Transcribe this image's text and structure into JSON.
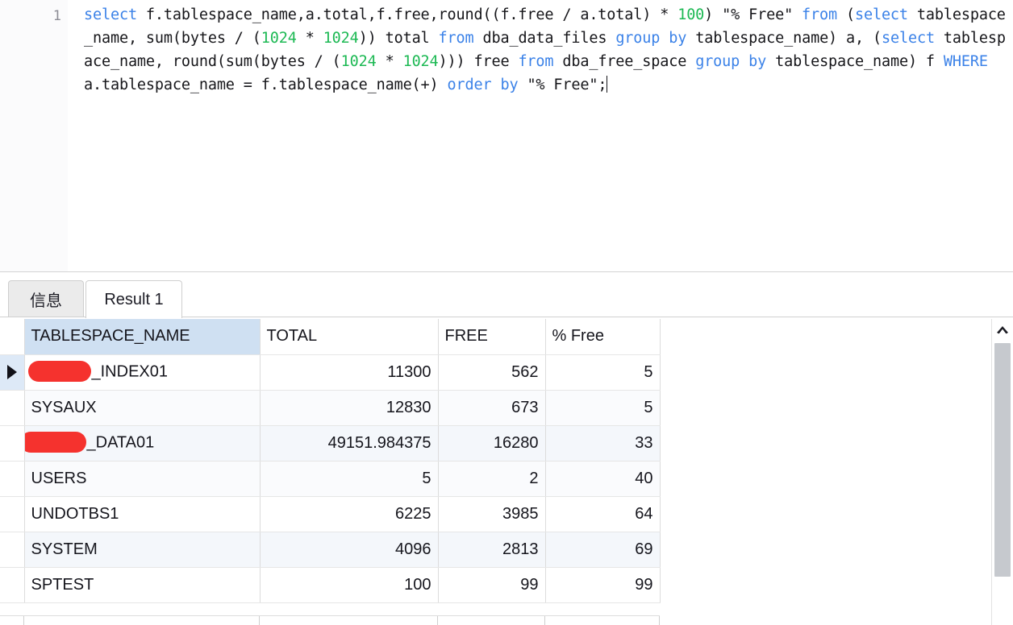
{
  "editor": {
    "line_number": "1",
    "sql_tokens": [
      {
        "t": "select",
        "c": "kw"
      },
      {
        "t": " f.tablespace_name,a.total,f.free,round((f.free / a.total) * ",
        "c": "plain"
      },
      {
        "t": "100",
        "c": "num"
      },
      {
        "t": ") \"% Free\" ",
        "c": "plain"
      },
      {
        "t": "from",
        "c": "kw"
      },
      {
        "t": " (",
        "c": "plain"
      },
      {
        "t": "select",
        "c": "kw"
      },
      {
        "t": " tablespace_name, sum(bytes / (",
        "c": "plain"
      },
      {
        "t": "1024",
        "c": "num"
      },
      {
        "t": " * ",
        "c": "plain"
      },
      {
        "t": "1024",
        "c": "num"
      },
      {
        "t": ")) total ",
        "c": "plain"
      },
      {
        "t": "from",
        "c": "kw"
      },
      {
        "t": " dba_data_files ",
        "c": "plain"
      },
      {
        "t": "group",
        "c": "kw"
      },
      {
        "t": " ",
        "c": "plain"
      },
      {
        "t": "by",
        "c": "kw"
      },
      {
        "t": " tablespace_name) a, (",
        "c": "plain"
      },
      {
        "t": "select",
        "c": "kw"
      },
      {
        "t": " tablespace_name, round(sum(bytes / (",
        "c": "plain"
      },
      {
        "t": "1024",
        "c": "num"
      },
      {
        "t": " * ",
        "c": "plain"
      },
      {
        "t": "1024",
        "c": "num"
      },
      {
        "t": "))) free ",
        "c": "plain"
      },
      {
        "t": "from",
        "c": "kw"
      },
      {
        "t": " dba_free_space ",
        "c": "plain"
      },
      {
        "t": "group",
        "c": "kw"
      },
      {
        "t": " ",
        "c": "plain"
      },
      {
        "t": "by",
        "c": "kw"
      },
      {
        "t": " tablespace_name) f ",
        "c": "plain"
      },
      {
        "t": "WHERE",
        "c": "kw"
      },
      {
        "t": " a.tablespace_name = f.tablespace_name(+) ",
        "c": "plain"
      },
      {
        "t": "order",
        "c": "kw"
      },
      {
        "t": " ",
        "c": "plain"
      },
      {
        "t": "by",
        "c": "kw"
      },
      {
        "t": " \"% Free\";",
        "c": "plain"
      }
    ],
    "sql_plain": "select f.tablespace_name,a.total,f.free,round((f.free / a.total) * 100) \"% Free\" from (select tablespace_name, sum(bytes / (1024 * 1024)) total from dba_data_files group by tablespace_name) a, (select tablespace_name, round(sum(bytes / (1024 * 1024))) free from dba_free_space group by tablespace_name) f WHERE a.tablespace_name = f.tablespace_name(+) order by \"% Free\";"
  },
  "tabs": [
    {
      "label": "信息",
      "active": false
    },
    {
      "label": "Result 1",
      "active": true
    }
  ],
  "grid": {
    "columns": [
      "TABLESPACE_NAME",
      "TOTAL",
      "FREE",
      "% Free"
    ],
    "rows": [
      {
        "name": "_INDEX01",
        "redacted": true,
        "total": "11300",
        "free": "562",
        "pct": "5",
        "selected": true
      },
      {
        "name": "SYSAUX",
        "redacted": false,
        "total": "12830",
        "free": "673",
        "pct": "5",
        "selected": false
      },
      {
        "name": "_DATA01",
        "redacted": true,
        "total": "49151.984375",
        "free": "16280",
        "pct": "33",
        "selected": false
      },
      {
        "name": "USERS",
        "redacted": false,
        "total": "5",
        "free": "2",
        "pct": "40",
        "selected": false
      },
      {
        "name": "UNDOTBS1",
        "redacted": false,
        "total": "6225",
        "free": "3985",
        "pct": "64",
        "selected": false
      },
      {
        "name": "SYSTEM",
        "redacted": false,
        "total": "4096",
        "free": "2813",
        "pct": "69",
        "selected": false
      },
      {
        "name": "SPTEST",
        "redacted": false,
        "total": "100",
        "free": "99",
        "pct": "99",
        "selected": false
      }
    ]
  },
  "colors": {
    "keyword": "#3b82e8",
    "number": "#1db954",
    "text": "#16161a",
    "header_highlight": "#cfe0f2",
    "row_selected": "#dde9f7",
    "redaction": "#f5322e"
  },
  "scrollbar": {
    "up_arrow_icon": "chevron-up-icon"
  }
}
